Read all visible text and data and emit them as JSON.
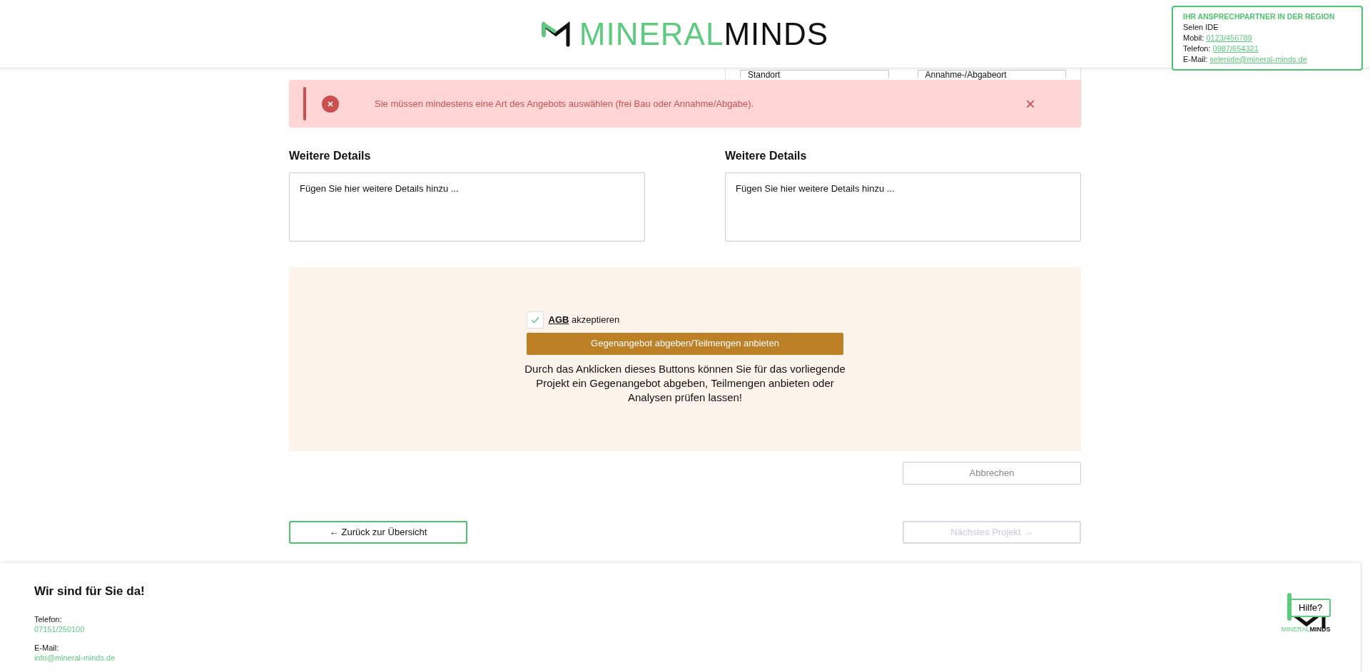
{
  "header": {
    "logo_light": "MINERAL",
    "logo_bold": "MINDS"
  },
  "contact": {
    "title": "IHR ANSPRECHPARTNER IN DER REGION",
    "name": "Selen IDE",
    "lines": [
      {
        "label": "Mobil:",
        "value": "0123/456789"
      },
      {
        "label": "Telefon:",
        "value": "0987/654321"
      },
      {
        "label": "E-Mail:",
        "value": "selenide@mineral-minds.de"
      }
    ]
  },
  "location_panel": {
    "legends": [
      "Standort",
      "Annahme-/Abgabeort"
    ]
  },
  "alert": {
    "message": "Sie müssen mindestens eine Art des Angebots auswählen (frei Bau oder Annahme/Abgabe).",
    "close": "×"
  },
  "details": [
    {
      "heading": "Weitere Details",
      "placeholder": "Fügen Sie hier weitere Details hinzu ..."
    },
    {
      "heading": "Weitere Details",
      "placeholder": "Fügen Sie hier weitere Details hinzu ..."
    }
  ],
  "offer": {
    "agb_link": "AGB",
    "agb_text": "akzeptieren",
    "checked": true,
    "button": "Gegenangebot abgeben/Teilmengen anbieten",
    "description": "Durch das Anklicken dieses Buttons können Sie für das vorliegende Projekt ein Gegenangebot abgeben, Teilmengen anbieten oder Analysen prüfen lassen!"
  },
  "cancel_button": {
    "label": "Abbrechen"
  },
  "nav_buttons": [
    {
      "label": "Zurück zur Übersicht",
      "arrow": "←",
      "kind": "back",
      "disabled": false
    },
    {
      "label": "Nächstes Projekt",
      "arrow": "→",
      "kind": "next",
      "disabled": true
    }
  ],
  "footer": {
    "heading": "Wir sind für Sie da!",
    "contacts": [
      {
        "label": "Telefon:",
        "value": "07151/250100"
      },
      {
        "label": "E-Mail:",
        "value": "info@mineral-minds.de"
      }
    ],
    "help": "Hilfe?",
    "mini_logo_light": "MINERAL",
    "mini_logo_bold": "MINDS"
  }
}
